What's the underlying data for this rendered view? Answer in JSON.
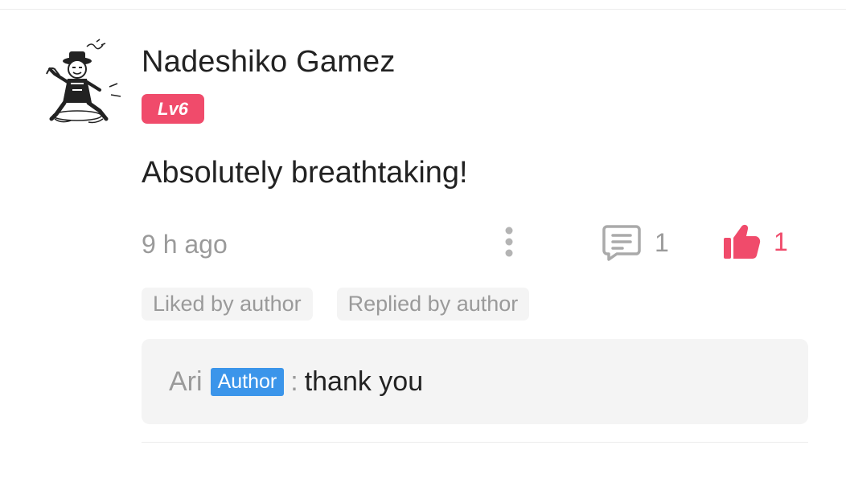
{
  "comment": {
    "username": "Nadeshiko Gamez",
    "level": "Lv6",
    "text": "Absolutely breathtaking!",
    "timestamp": "9 h ago",
    "reply_count": "1",
    "like_count": "1",
    "liked": true,
    "tags": [
      "Liked by author",
      "Replied by author"
    ]
  },
  "reply": {
    "name": "Ari",
    "badge": "Author",
    "separator": ":",
    "text": "thank you"
  },
  "icons": {
    "avatar": "manga-character-avatar",
    "more": "vertical-dots-icon",
    "reply": "comment-bubble-icon",
    "like": "thumbs-up-icon"
  },
  "colors": {
    "accent": "#f04b6b",
    "author_badge": "#3b95ea",
    "muted_text": "#9a9a9a",
    "body_text": "#222222",
    "chip_background": "#f4f4f4"
  }
}
